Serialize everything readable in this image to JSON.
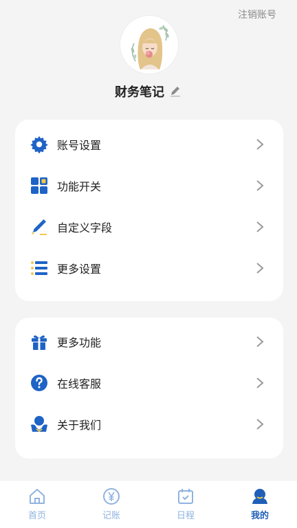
{
  "header": {
    "logout_label": "注销账号"
  },
  "profile": {
    "name": "财务笔记",
    "avatar_icon": "avatar-illustration",
    "edit_icon": "pencil-icon"
  },
  "settings_group": {
    "items": [
      {
        "label": "账号设置",
        "icon": "gear-icon"
      },
      {
        "label": "功能开关",
        "icon": "grid-icon"
      },
      {
        "label": "自定义字段",
        "icon": "pencil-edit-icon"
      },
      {
        "label": "更多设置",
        "icon": "list-icon"
      }
    ]
  },
  "more_group": {
    "items": [
      {
        "label": "更多功能",
        "icon": "gift-icon"
      },
      {
        "label": "在线客服",
        "icon": "question-icon"
      },
      {
        "label": "关于我们",
        "icon": "people-icon"
      }
    ]
  },
  "tabbar": {
    "tabs": [
      {
        "label": "首页",
        "icon": "home-icon",
        "active": false
      },
      {
        "label": "记账",
        "icon": "yen-icon",
        "active": false
      },
      {
        "label": "日程",
        "icon": "calendar-icon",
        "active": false
      },
      {
        "label": "我的",
        "icon": "user-icon",
        "active": true
      }
    ]
  },
  "colors": {
    "accent": "#1f5fb8",
    "icon_blue": "#1e63c6",
    "inactive_tab": "#8fb3df",
    "background": "#f4f4f4",
    "accent_yellow": "#f2c94c"
  }
}
